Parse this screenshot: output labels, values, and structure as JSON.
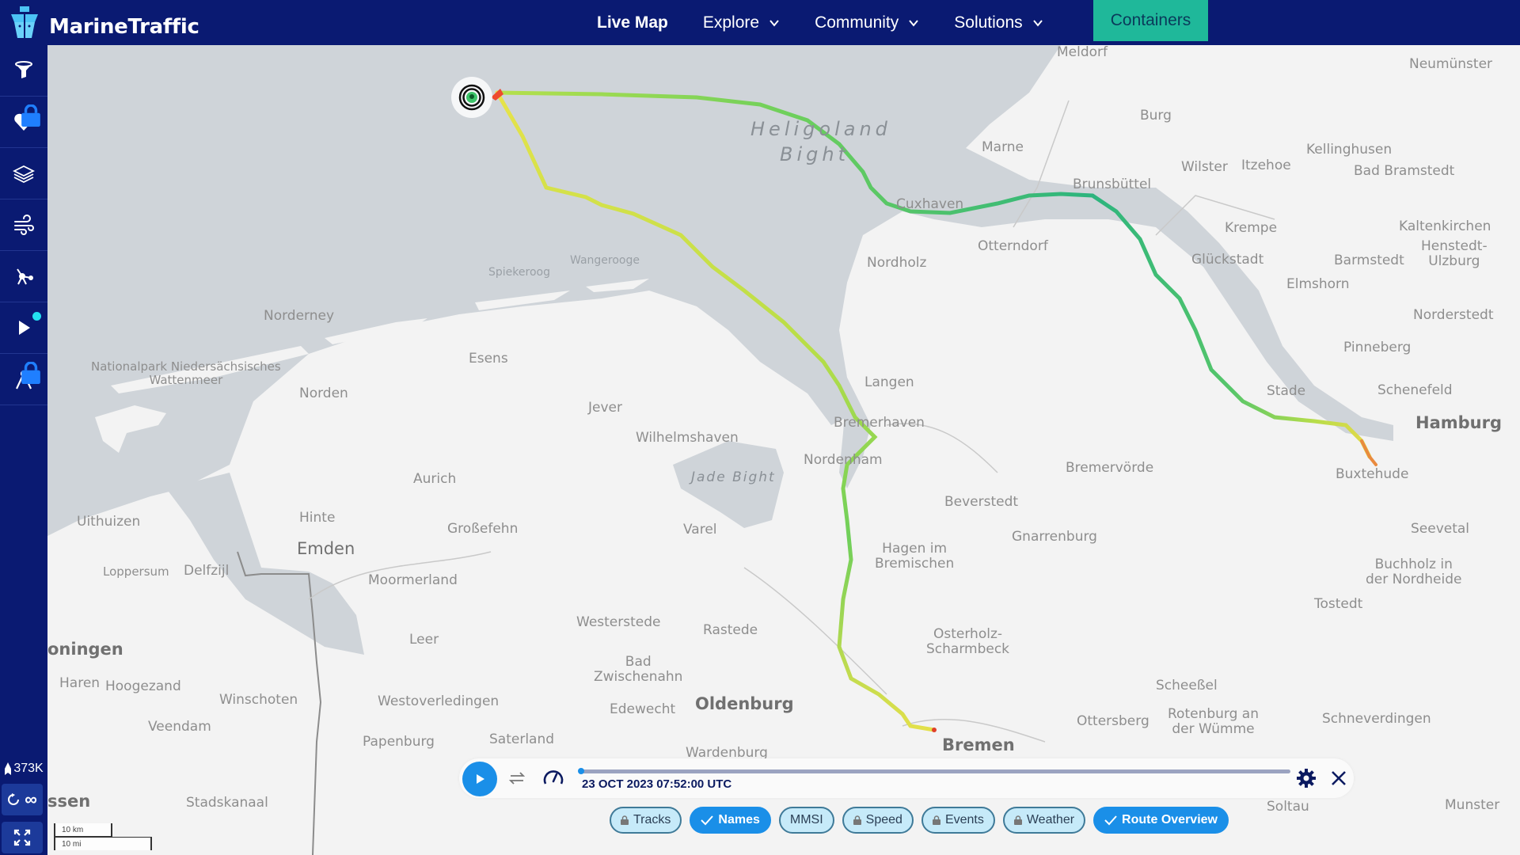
{
  "app": {
    "brand": "MarineTraffic"
  },
  "nav": {
    "items": [
      {
        "label": "Live Map",
        "active": true,
        "dropdown": false
      },
      {
        "label": "Explore",
        "active": false,
        "dropdown": true
      },
      {
        "label": "Community",
        "active": false,
        "dropdown": true
      },
      {
        "label": "Solutions",
        "active": false,
        "dropdown": true
      }
    ],
    "cta": "Containers"
  },
  "sidebar": {
    "items": [
      {
        "icon": "filter-icon",
        "locked": false,
        "dot": false
      },
      {
        "icon": "heart-icon",
        "locked": true,
        "dot": false
      },
      {
        "icon": "layers-icon",
        "locked": false,
        "dot": false
      },
      {
        "icon": "wind-icon",
        "locked": false,
        "dot": false
      },
      {
        "icon": "network-icon",
        "locked": false,
        "dot": false
      },
      {
        "icon": "play-icon",
        "locked": false,
        "dot": true
      },
      {
        "icon": "compass-icon",
        "locked": true,
        "dot": false
      }
    ],
    "vessel_count": "373K",
    "replay_label": "∞"
  },
  "map": {
    "scale": {
      "km": "10 km",
      "mi": "10 mi"
    },
    "labels": {
      "sea": [
        "Heligoland",
        "Bight"
      ],
      "jade": "Jade Bight",
      "meldorf": "Meldorf",
      "neumunster": "Neumünster",
      "burg": "Burg",
      "marne": "Marne",
      "kellinghusen": "Kellinghusen",
      "wilster": "Wilster",
      "itzehoe": "Itzehoe",
      "bad_bramstedt": "Bad Bramstedt",
      "brunsbuttel": "Brunsbüttel",
      "cuxhaven": "Cuxhaven",
      "krempe": "Krempe",
      "kaltenkirchen": "Kaltenkirchen",
      "henstedt": "Henstedt-\nUlzburg",
      "nordholz": "Nordholz",
      "otterndorf": "Otterndorf",
      "gluckstadt": "Glückstadt",
      "barmstedt": "Barmstedt",
      "elmshorn": "Elmshorn",
      "norderstedt": "Norderstedt",
      "pinneberg": "Pinneberg",
      "spiekeroog": "Spiekeroog",
      "wangerooge": "Wangerooge",
      "norderney": "Norderney",
      "nationalpark": "Nationalpark Niedersächsisches\nWattenmeer",
      "esens": "Esens",
      "norden": "Norden",
      "jever": "Jever",
      "langen": "Langen",
      "stade": "Stade",
      "schenefeld": "Schenefeld",
      "hamburg": "Hamburg",
      "bremerhaven": "Bremerhaven",
      "wilhelmshaven": "Wilhelmshaven",
      "nordenham": "Nordenham",
      "aurich": "Aurich",
      "bremervorde": "Bremervörde",
      "buxtehude": "Buxtehude",
      "beverstedt": "Beverstedt",
      "uithuizen": "Uithuizen",
      "hinte": "Hinte",
      "grossefehn": "Großefehn",
      "varel": "Varel",
      "gnarrenburg": "Gnarrenburg",
      "seevetal": "Seevetal",
      "hagen": "Hagen im\nBremischen",
      "emden": "Emden",
      "loppersum": "Loppersum",
      "delfzijl": "Delfzijl",
      "moormerland": "Moormerland",
      "buchholz": "Buchholz in\nder Nordheide",
      "tostedt": "Tostedt",
      "westerstede": "Westerstede",
      "rastede": "Rastede",
      "osterholz": "Osterholz-\nScharmbeck",
      "groningen": "oningen",
      "leer": "Leer",
      "bad_zwischenahn": "Bad\nZwischenahn",
      "haren": "Haren",
      "hoogezand": "Hoogezand",
      "winschoten": "Winschoten",
      "westoverledingen": "Westoverledingen",
      "edewecht": "Edewecht",
      "oldenburg": "Oldenburg",
      "scheessel": "Scheeßel",
      "veendam": "Veendam",
      "ottersberg": "Ottersberg",
      "rotenburg": "Rotenburg an\nder Wümme",
      "schneverdingen": "Schneverdingen",
      "papenburg": "Papenburg",
      "saterland": "Saterland",
      "wardenburg": "Wardenburg",
      "bremen": "Bremen",
      "assen": "ssen",
      "stadskanaal": "Stadskanaal",
      "soltau": "Soltau",
      "munster": "Munster"
    }
  },
  "player": {
    "timestamp": "23 OCT 2023 07:52:00 UTC",
    "progress": 0.0
  },
  "chips": [
    {
      "label": "Tracks",
      "state": "locked"
    },
    {
      "label": "Names",
      "state": "on"
    },
    {
      "label": "MMSI",
      "state": "off"
    },
    {
      "label": "Speed",
      "state": "locked"
    },
    {
      "label": "Events",
      "state": "locked"
    },
    {
      "label": "Weather",
      "state": "locked"
    },
    {
      "label": "Route Overview",
      "state": "on"
    }
  ],
  "colors": {
    "nav_bg": "#0a1a72",
    "cta_bg": "#1fb89a",
    "accent": "#1a8fe8",
    "water": "#cfd4d9",
    "land": "#f3f3f3"
  }
}
